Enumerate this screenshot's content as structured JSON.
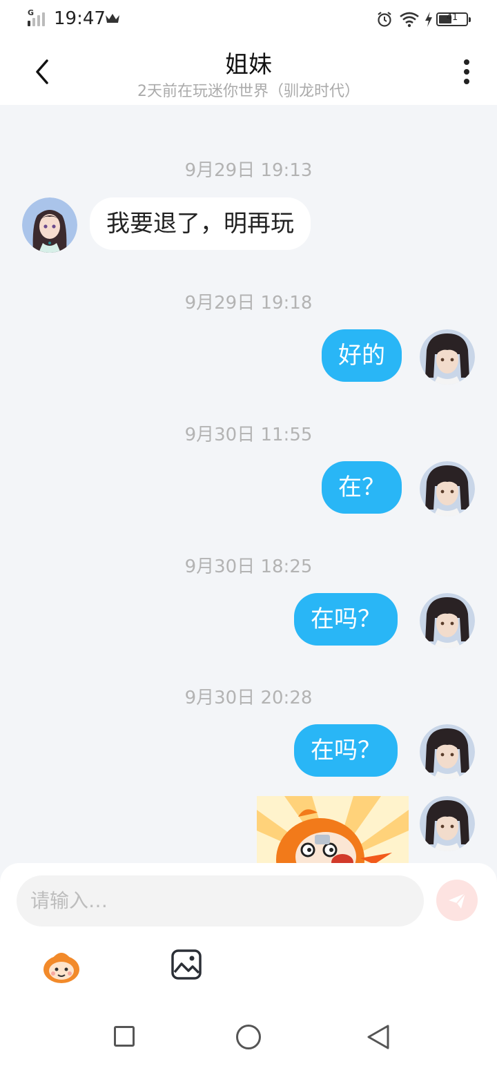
{
  "status_bar": {
    "network": "G",
    "time": "19:47",
    "battery": "41"
  },
  "header": {
    "title": "姐妹",
    "subtitle": "2天前在玩迷你世界（驯龙时代）"
  },
  "messages": [
    {
      "timestamp": "9月29日 19:13",
      "side": "left",
      "text": "我要退了，明再玩"
    },
    {
      "timestamp": "9月29日 19:18",
      "side": "right",
      "text": "好的"
    },
    {
      "timestamp": "9月30日 11:55",
      "side": "right",
      "text": "在？"
    },
    {
      "timestamp": "9月30日 18:25",
      "side": "right",
      "text": "在吗？"
    },
    {
      "timestamp": "9月30日 20:28",
      "side": "right",
      "text": "在吗？"
    }
  ],
  "composer": {
    "placeholder": "请输入…"
  },
  "colors": {
    "sent_bubble": "#29b6f6",
    "received_bubble": "#ffffff",
    "chat_background": "#f3f5f8",
    "send_button": "#fde3e1"
  },
  "icons": {
    "back": "back-arrow-icon",
    "more": "more-vertical-icon",
    "send": "send-icon",
    "emoji": "emoji-icon",
    "image": "image-icon"
  }
}
